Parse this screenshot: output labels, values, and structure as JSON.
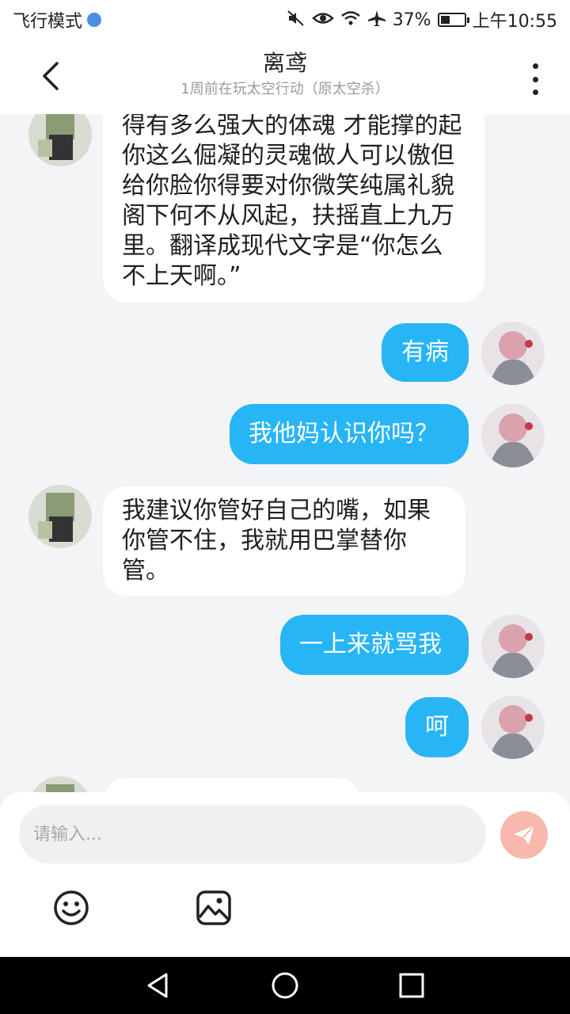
{
  "status": {
    "mode": "飞行模式",
    "battery": "37%",
    "battery_level": 0.37,
    "time": "上午10:55"
  },
  "header": {
    "title": "离鸢",
    "subtitle": "1周前在玩太空行动（原太空杀）"
  },
  "messages": [
    {
      "side": "left",
      "text": "得有多么强大的体魂 才能撑的起你这么倔凝的灵魂做人可以傲但给你脸你得要对你微笑纯属礼貌  阁下何不从风起，扶摇直上九万里。翻译成现代文字是“你怎么不上天啊。”"
    },
    {
      "side": "right",
      "text": "有病"
    },
    {
      "side": "right",
      "text": "我他妈认识你吗？"
    },
    {
      "side": "left",
      "text": "我建议你管好自己的嘴，如果你管不住，我就用巴掌替你管。"
    },
    {
      "side": "right",
      "text": "一上来就骂我"
    },
    {
      "side": "right",
      "text": "呵"
    }
  ],
  "input": {
    "placeholder": "请输入..."
  },
  "icons": {
    "emoji": "smiley-icon",
    "image": "image-icon",
    "send": "send-icon",
    "send_color": "#f8b8ad",
    "accent": "#27b5f6"
  }
}
